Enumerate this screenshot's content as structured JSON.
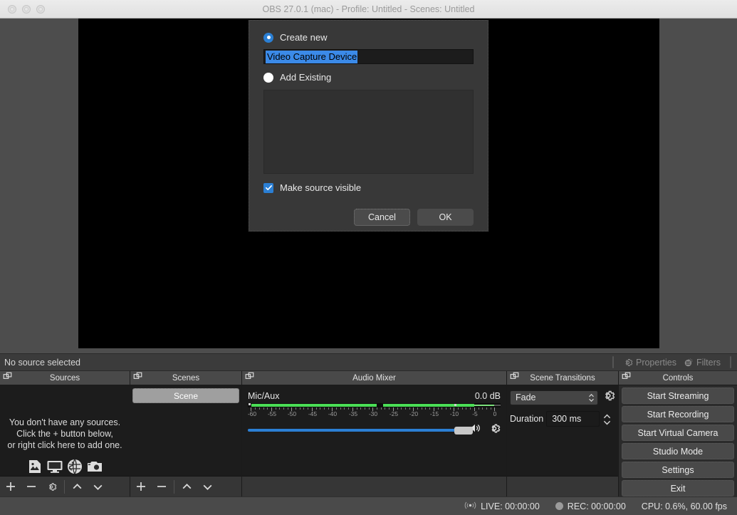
{
  "window": {
    "title": "OBS 27.0.1 (mac) - Profile: Untitled - Scenes: Untitled"
  },
  "source_toolbar": {
    "status": "No source selected",
    "properties_label": "Properties",
    "filters_label": "Filters"
  },
  "docks": {
    "sources": {
      "title": "Sources",
      "empty_line1": "You don't have any sources.",
      "empty_line2": "Click the + button below,",
      "empty_line3": "or right click here to add one."
    },
    "scenes": {
      "title": "Scenes",
      "items": [
        {
          "label": "Scene",
          "selected": true
        }
      ]
    },
    "mixer": {
      "title": "Audio Mixer",
      "channel_name": "Mic/Aux",
      "level_db": "0.0 dB",
      "scale_labels": [
        "-60",
        "-55",
        "-50",
        "-45",
        "-40",
        "-35",
        "-30",
        "-25",
        "-20",
        "-15",
        "-10",
        "-5",
        "0"
      ]
    },
    "transitions": {
      "title": "Scene Transitions",
      "transition": "Fade",
      "duration_label": "Duration",
      "duration_value": "300 ms"
    },
    "controls": {
      "title": "Controls",
      "buttons": [
        "Start Streaming",
        "Start Recording",
        "Start Virtual Camera",
        "Studio Mode",
        "Settings",
        "Exit"
      ]
    }
  },
  "statusbar": {
    "live": "LIVE: 00:00:00",
    "rec": "REC: 00:00:00",
    "cpu": "CPU: 0.6%, 60.00 fps"
  },
  "dialog": {
    "create_new_label": "Create new",
    "create_new_selected": true,
    "source_name_value": "Video Capture Device",
    "add_existing_label": "Add Existing",
    "add_existing_selected": false,
    "make_visible_label": "Make source visible",
    "make_visible_checked": true,
    "cancel_label": "Cancel",
    "ok_label": "OK"
  },
  "colors": {
    "accent_blue": "#2b7fd4",
    "selection_blue": "#3b8ae8",
    "meter_green": "#4ade55",
    "window_chrome": "#e0e0e0"
  },
  "chart_data": {
    "type": "bar",
    "title": "Mic/Aux audio level meter",
    "xlabel": "dB",
    "categories": [
      "-60",
      "-55",
      "-50",
      "-45",
      "-40",
      "-35",
      "-30",
      "-25",
      "-20",
      "-15",
      "-10",
      "-5",
      "0"
    ],
    "values": [
      1,
      1,
      1,
      1,
      1,
      1,
      1,
      1,
      1,
      0,
      0,
      0,
      0
    ],
    "xlim": [
      -60,
      0
    ],
    "grid": false
  }
}
